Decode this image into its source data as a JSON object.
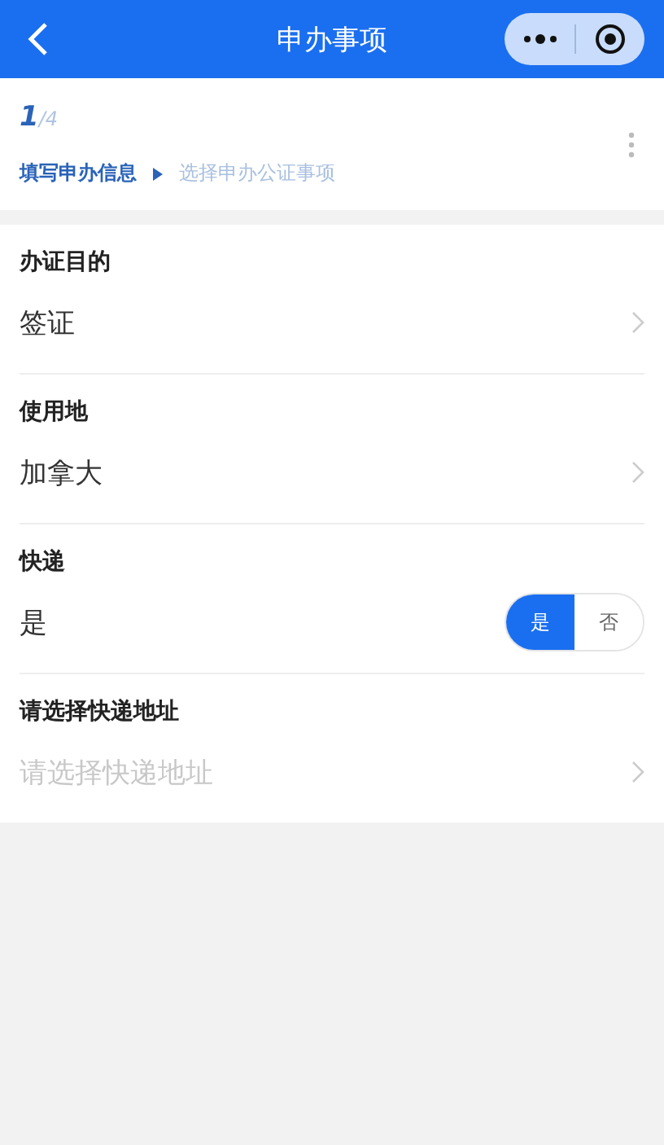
{
  "header": {
    "title": "申办事项"
  },
  "progress": {
    "current": "1",
    "total": "/4"
  },
  "steps": [
    {
      "label": "填写申办信息",
      "selected": true
    },
    {
      "label": "选择申办公证事项",
      "selected": false
    }
  ],
  "fields": [
    {
      "kind": "select",
      "label": "办证目的",
      "value": "签证"
    },
    {
      "kind": "select",
      "label": "使用地",
      "value": "加拿大"
    },
    {
      "kind": "toggle",
      "label": "快递",
      "value": "是",
      "options": [
        {
          "label": "是",
          "selected": true
        },
        {
          "label": "否",
          "selected": false
        }
      ]
    },
    {
      "kind": "select",
      "label": "请选择快递地址",
      "placeholder": "请选择快递地址"
    }
  ]
}
